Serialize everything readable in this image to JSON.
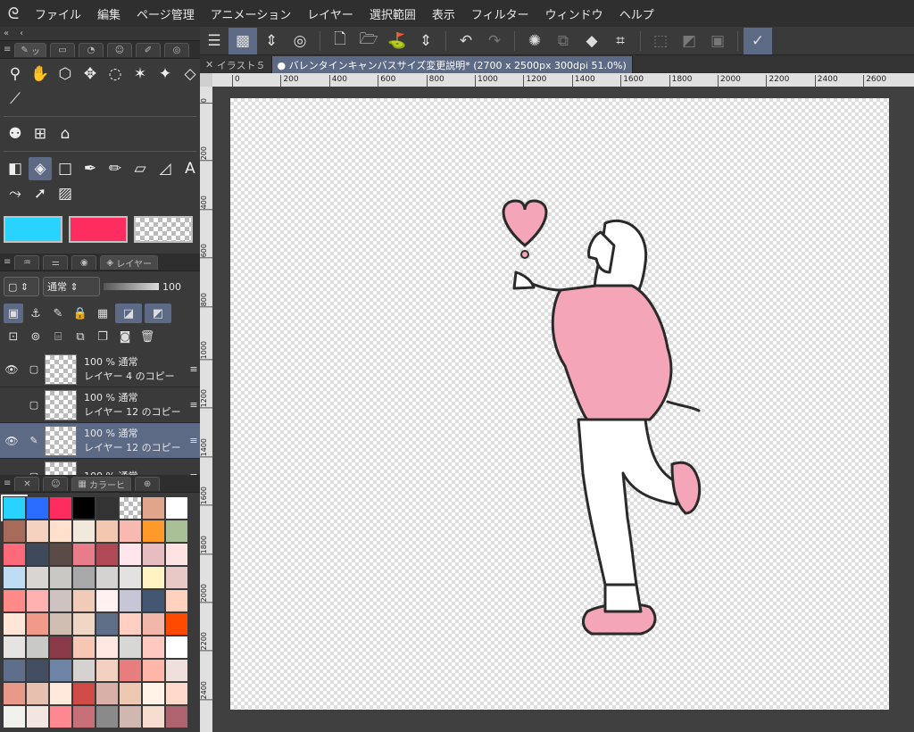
{
  "menu": {
    "logo": "ᘓ",
    "items": [
      "ファイル",
      "編集",
      "ページ管理",
      "アニメーション",
      "レイヤー",
      "選択範囲",
      "表示",
      "フィルター",
      "ウィンドウ",
      "ヘルプ"
    ]
  },
  "left_panel": {
    "collapse_left": "«",
    "collapse_arrow": "‹",
    "tool_tab_mark": "ッ",
    "layer_tab_label": "レイヤー",
    "blend_mode": "通常",
    "opacity": "100",
    "palette_tab_label": "カラーヒ"
  },
  "colors": {
    "main": "#29d3ff",
    "sub": "#ff2d5f",
    "accent": "#5d6a86"
  },
  "layers": [
    {
      "line1": "100 % 通常",
      "line2": "レイヤー 4 のコピー",
      "visible": true,
      "selected": false
    },
    {
      "line1": "100 % 通常",
      "line2": "レイヤー 12 のコピー",
      "visible": false,
      "selected": false
    },
    {
      "line1": "100 % 通常",
      "line2": "レイヤー 12 のコピー",
      "visible": true,
      "selected": true
    },
    {
      "line1": "100 % 通常",
      "line2": "",
      "visible": false,
      "selected": false
    }
  ],
  "palette": [
    "#29d3ff",
    "#2a6cff",
    "#ff2d5f",
    "#000000",
    "#333333",
    "checker",
    "#e0a58a",
    "#ffffff",
    "#a86a5a",
    "#f5d2c0",
    "#ffe0cc",
    "#f2e9dd",
    "#f4c8b0",
    "#f7b9b0",
    "#ff9a2a",
    "#a9bf96",
    "#ff6a7a",
    "#3e4a5c",
    "#5a4a48",
    "#e87c88",
    "#b04855",
    "#ffe6ec",
    "#e8bdbf",
    "#ffe2e2",
    "#bfdcf5",
    "#d9d5d3",
    "#c9c8c4",
    "#a8a7aa",
    "#d4d3d2",
    "#e3e2e0",
    "#fff3c4",
    "#e8c9c5",
    "#ff8a88",
    "#ffb0b0",
    "#cfc3c2",
    "#f2cab8",
    "#fff0f2",
    "#c6c6d6",
    "#435672",
    "#ffd1bf",
    "#ffe6d6",
    "#f29a8a",
    "#d0beb3",
    "#f0d6c4",
    "#5e6f87",
    "#ffcfc2",
    "#f2b6ab",
    "#ff4a00",
    "#e6e3e0",
    "#c9c9c7",
    "#8a3a48",
    "#f7c7b5",
    "#ffe8e2",
    "#d7d7d5",
    "#ffc8c0",
    "#ffffff",
    "#5f6e8a",
    "#444e62",
    "#6f85a8",
    "#d5d2d0",
    "#f3d0c0",
    "#e87d7d",
    "#ffb6a8",
    "#f0e0dc",
    "#e8998a",
    "#e8c0b0",
    "#ffe8dc",
    "#d04a48",
    "#d8b0a8",
    "#efc8b2",
    "#fff3e8",
    "#ffd9c9",
    "#f0f0ec",
    "#f3e6e0",
    "#ff8890",
    "#c87078",
    "#8a8a8a",
    "#d0b8b0",
    "#f7dcd0",
    "#b06470"
  ],
  "document_tabs": [
    {
      "label": "イラスト５",
      "active": false
    },
    {
      "label": "● バレンタインキャンバスサイズ変更説明* (2700 x 2500px 300dpi 51.0%)",
      "active": true
    }
  ],
  "rulers": {
    "h_ticks": [
      "0",
      "200",
      "400",
      "600",
      "800",
      "1000",
      "1200",
      "1400",
      "1600",
      "1800",
      "2000",
      "2200",
      "2400",
      "2600"
    ],
    "v_ticks": [
      "0",
      "200",
      "400",
      "600",
      "800",
      "1000",
      "1200",
      "1400",
      "1600",
      "1800",
      "2000",
      "2200",
      "2400"
    ]
  },
  "illustration": {
    "hoodie_color": "#f4a6b8",
    "outline_color": "#2a2a2a"
  }
}
